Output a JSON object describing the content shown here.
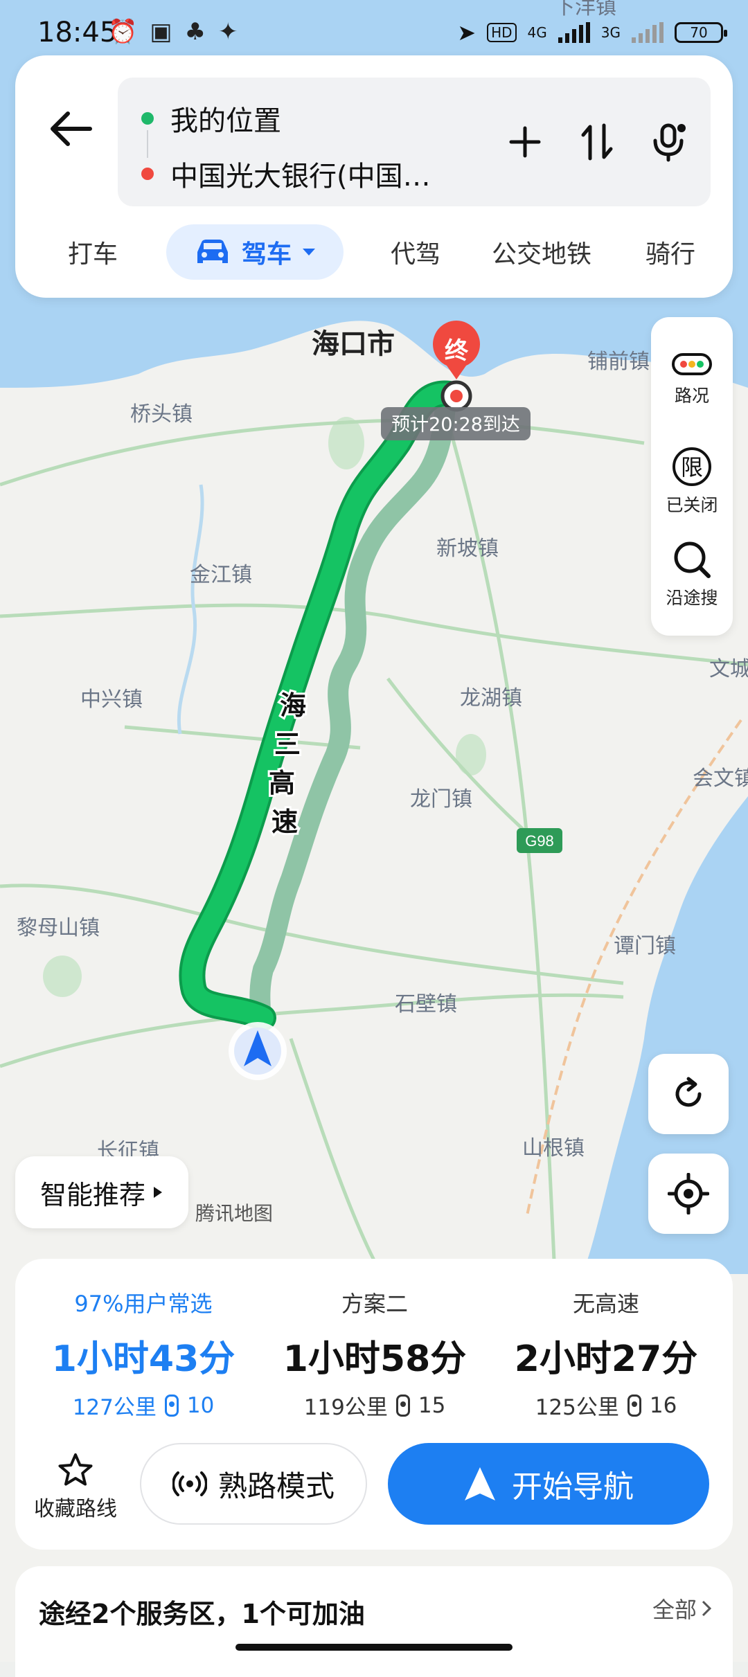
{
  "status_bar": {
    "time": "18:45",
    "network_hd": "HD",
    "network_4g": "4G",
    "network_3g": "3G",
    "battery": "70"
  },
  "search": {
    "origin": "我的位置",
    "destination": "中国光大银行(中国…"
  },
  "modes": [
    "打车",
    "驾车",
    "代驾",
    "公交地铁",
    "骑行"
  ],
  "map": {
    "city_label": "海口市",
    "end_marker": "终",
    "eta_label": "预计20:28到达",
    "route_name": [
      "海",
      "三",
      "高",
      "速"
    ],
    "highway_shield": "G98",
    "places": [
      "铺前镇",
      "桥头镇",
      "新坡镇",
      "金江镇",
      "中兴镇",
      "龙湖镇",
      "龙门镇",
      "会文镇",
      "黎母山镇",
      "谭门镇",
      "石壁镇",
      "山根镇",
      "长征镇",
      "文城",
      "下洋镇"
    ],
    "watermark": "腾讯地图"
  },
  "tools": {
    "traffic": "路况",
    "restriction_icon": "限",
    "restriction": "已关闭",
    "along_search": "沿途搜"
  },
  "smart_recommend": "智能推荐",
  "route_options": [
    {
      "tag": "97%用户常选",
      "duration": "1小时43分",
      "distance": "127公里",
      "lights": "10",
      "selected": true
    },
    {
      "tag": "方案二",
      "duration": "1小时58分",
      "distance": "119公里",
      "lights": "15",
      "selected": false
    },
    {
      "tag": "无高速",
      "duration": "2小时27分",
      "distance": "125公里",
      "lights": "16",
      "selected": false
    }
  ],
  "actions": {
    "favorite": "收藏路线",
    "familiar_mode": "熟路模式",
    "start_navigation": "开始导航"
  },
  "service": {
    "text": "途经2个服务区，1个可加油",
    "all": "全部"
  },
  "colors": {
    "accent": "#1d7ff2",
    "route_primary": "#0fb85c",
    "route_alt": "#8fc4a6",
    "sea": "#aad3f3",
    "end_marker": "#f0493f"
  }
}
